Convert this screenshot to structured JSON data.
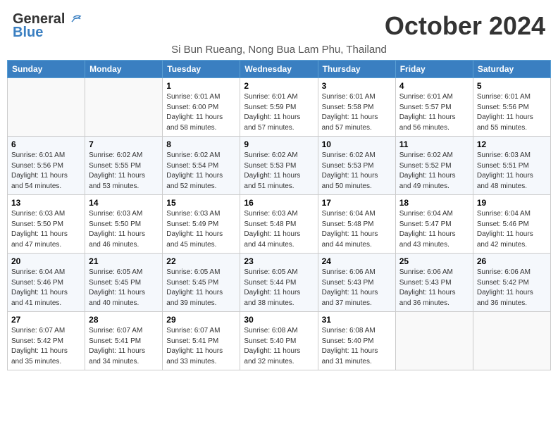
{
  "header": {
    "logo_line1": "General",
    "logo_line2": "Blue",
    "month_title": "October 2024",
    "subtitle": "Si Bun Rueang, Nong Bua Lam Phu, Thailand"
  },
  "weekdays": [
    "Sunday",
    "Monday",
    "Tuesday",
    "Wednesday",
    "Thursday",
    "Friday",
    "Saturday"
  ],
  "weeks": [
    [
      {
        "day": "",
        "info": ""
      },
      {
        "day": "",
        "info": ""
      },
      {
        "day": "1",
        "info": "Sunrise: 6:01 AM\nSunset: 6:00 PM\nDaylight: 11 hours and 58 minutes."
      },
      {
        "day": "2",
        "info": "Sunrise: 6:01 AM\nSunset: 5:59 PM\nDaylight: 11 hours and 57 minutes."
      },
      {
        "day": "3",
        "info": "Sunrise: 6:01 AM\nSunset: 5:58 PM\nDaylight: 11 hours and 57 minutes."
      },
      {
        "day": "4",
        "info": "Sunrise: 6:01 AM\nSunset: 5:57 PM\nDaylight: 11 hours and 56 minutes."
      },
      {
        "day": "5",
        "info": "Sunrise: 6:01 AM\nSunset: 5:56 PM\nDaylight: 11 hours and 55 minutes."
      }
    ],
    [
      {
        "day": "6",
        "info": "Sunrise: 6:01 AM\nSunset: 5:56 PM\nDaylight: 11 hours and 54 minutes."
      },
      {
        "day": "7",
        "info": "Sunrise: 6:02 AM\nSunset: 5:55 PM\nDaylight: 11 hours and 53 minutes."
      },
      {
        "day": "8",
        "info": "Sunrise: 6:02 AM\nSunset: 5:54 PM\nDaylight: 11 hours and 52 minutes."
      },
      {
        "day": "9",
        "info": "Sunrise: 6:02 AM\nSunset: 5:53 PM\nDaylight: 11 hours and 51 minutes."
      },
      {
        "day": "10",
        "info": "Sunrise: 6:02 AM\nSunset: 5:53 PM\nDaylight: 11 hours and 50 minutes."
      },
      {
        "day": "11",
        "info": "Sunrise: 6:02 AM\nSunset: 5:52 PM\nDaylight: 11 hours and 49 minutes."
      },
      {
        "day": "12",
        "info": "Sunrise: 6:03 AM\nSunset: 5:51 PM\nDaylight: 11 hours and 48 minutes."
      }
    ],
    [
      {
        "day": "13",
        "info": "Sunrise: 6:03 AM\nSunset: 5:50 PM\nDaylight: 11 hours and 47 minutes."
      },
      {
        "day": "14",
        "info": "Sunrise: 6:03 AM\nSunset: 5:50 PM\nDaylight: 11 hours and 46 minutes."
      },
      {
        "day": "15",
        "info": "Sunrise: 6:03 AM\nSunset: 5:49 PM\nDaylight: 11 hours and 45 minutes."
      },
      {
        "day": "16",
        "info": "Sunrise: 6:03 AM\nSunset: 5:48 PM\nDaylight: 11 hours and 44 minutes."
      },
      {
        "day": "17",
        "info": "Sunrise: 6:04 AM\nSunset: 5:48 PM\nDaylight: 11 hours and 44 minutes."
      },
      {
        "day": "18",
        "info": "Sunrise: 6:04 AM\nSunset: 5:47 PM\nDaylight: 11 hours and 43 minutes."
      },
      {
        "day": "19",
        "info": "Sunrise: 6:04 AM\nSunset: 5:46 PM\nDaylight: 11 hours and 42 minutes."
      }
    ],
    [
      {
        "day": "20",
        "info": "Sunrise: 6:04 AM\nSunset: 5:46 PM\nDaylight: 11 hours and 41 minutes."
      },
      {
        "day": "21",
        "info": "Sunrise: 6:05 AM\nSunset: 5:45 PM\nDaylight: 11 hours and 40 minutes."
      },
      {
        "day": "22",
        "info": "Sunrise: 6:05 AM\nSunset: 5:45 PM\nDaylight: 11 hours and 39 minutes."
      },
      {
        "day": "23",
        "info": "Sunrise: 6:05 AM\nSunset: 5:44 PM\nDaylight: 11 hours and 38 minutes."
      },
      {
        "day": "24",
        "info": "Sunrise: 6:06 AM\nSunset: 5:43 PM\nDaylight: 11 hours and 37 minutes."
      },
      {
        "day": "25",
        "info": "Sunrise: 6:06 AM\nSunset: 5:43 PM\nDaylight: 11 hours and 36 minutes."
      },
      {
        "day": "26",
        "info": "Sunrise: 6:06 AM\nSunset: 5:42 PM\nDaylight: 11 hours and 36 minutes."
      }
    ],
    [
      {
        "day": "27",
        "info": "Sunrise: 6:07 AM\nSunset: 5:42 PM\nDaylight: 11 hours and 35 minutes."
      },
      {
        "day": "28",
        "info": "Sunrise: 6:07 AM\nSunset: 5:41 PM\nDaylight: 11 hours and 34 minutes."
      },
      {
        "day": "29",
        "info": "Sunrise: 6:07 AM\nSunset: 5:41 PM\nDaylight: 11 hours and 33 minutes."
      },
      {
        "day": "30",
        "info": "Sunrise: 6:08 AM\nSunset: 5:40 PM\nDaylight: 11 hours and 32 minutes."
      },
      {
        "day": "31",
        "info": "Sunrise: 6:08 AM\nSunset: 5:40 PM\nDaylight: 11 hours and 31 minutes."
      },
      {
        "day": "",
        "info": ""
      },
      {
        "day": "",
        "info": ""
      }
    ]
  ]
}
